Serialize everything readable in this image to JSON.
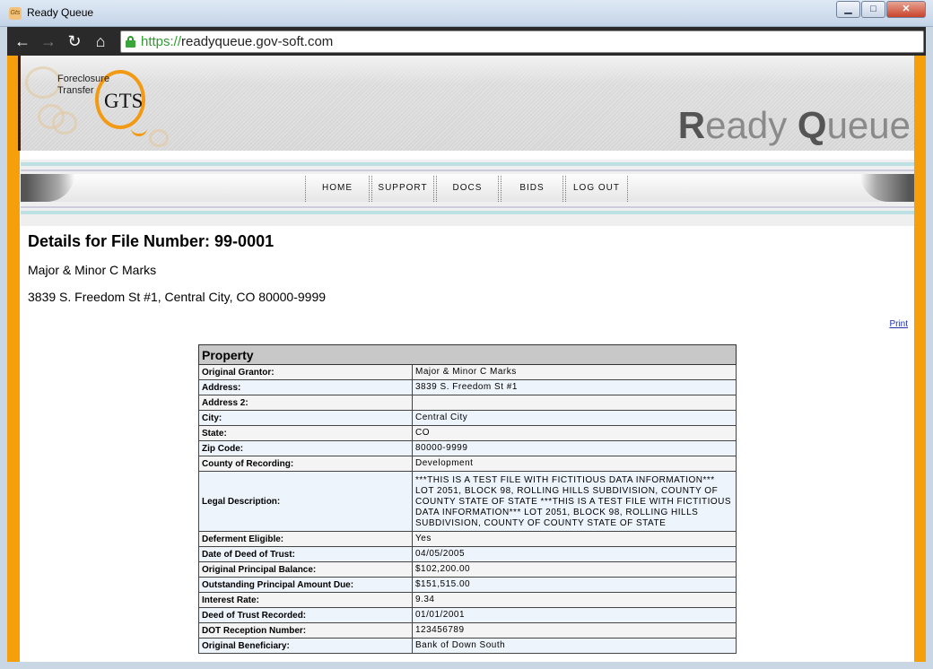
{
  "window": {
    "title": "Ready Queue",
    "controls": {
      "minimize": "▁",
      "maximize": "□",
      "close": "✕"
    }
  },
  "browser": {
    "url_scheme": "https://",
    "url_rest": "readyqueue.gov-soft.com",
    "icons": {
      "back": "←",
      "forward": "→",
      "reload": "↻",
      "home": "⌂"
    }
  },
  "header": {
    "logo_text": "Foreclosure\nTransfer",
    "logo_mark": "GTS",
    "brand_r": "R",
    "brand_eady": "eady ",
    "brand_q": "Q",
    "brand_ueue": "ueue"
  },
  "nav": [
    "HOME",
    "SUPPORT",
    "DOCS",
    "BIDS",
    "LOG OUT"
  ],
  "details": {
    "title": "Details for File Number: 99-0001",
    "owner": "Major & Minor C Marks",
    "address": "3839 S. Freedom St #1, Central City, CO 80000-9999",
    "print": "Print"
  },
  "property": {
    "heading": "Property",
    "rows": [
      {
        "label": "Original Grantor:",
        "value": "Major & Minor C Marks"
      },
      {
        "label": "Address:",
        "value": "3839 S. Freedom St #1"
      },
      {
        "label": "Address 2:",
        "value": ""
      },
      {
        "label": "City:",
        "value": "Central City"
      },
      {
        "label": "State:",
        "value": "CO"
      },
      {
        "label": "Zip Code:",
        "value": "80000-9999"
      },
      {
        "label": "County of Recording:",
        "value": "Development"
      },
      {
        "label": "Legal Description:",
        "value": "***THIS IS A TEST FILE WITH FICTITIOUS DATA INFORMATION*** LOT 2051, BLOCK 98, ROLLING HILLS SUBDIVISION, COUNTY OF COUNTY STATE OF STATE ***THIS IS A TEST FILE WITH FICTITIOUS DATA INFORMATION*** LOT 2051, BLOCK 98, ROLLING HILLS SUBDIVISION, COUNTY OF COUNTY STATE OF STATE"
      },
      {
        "label": "Deferment Eligible:",
        "value": "Yes"
      },
      {
        "label": "Date of Deed of Trust:",
        "value": "04/05/2005"
      },
      {
        "label": "Original Principal Balance:",
        "value": "$102,200.00"
      },
      {
        "label": "Outstanding Principal Amount Due:",
        "value": "$151,515.00"
      },
      {
        "label": "Interest Rate:",
        "value": "9.34"
      },
      {
        "label": "Deed of Trust Recorded:",
        "value": "01/01/2001"
      },
      {
        "label": "DOT Reception Number:",
        "value": "123456789"
      },
      {
        "label": "Original Beneficiary:",
        "value": "Bank of Down South"
      }
    ]
  }
}
